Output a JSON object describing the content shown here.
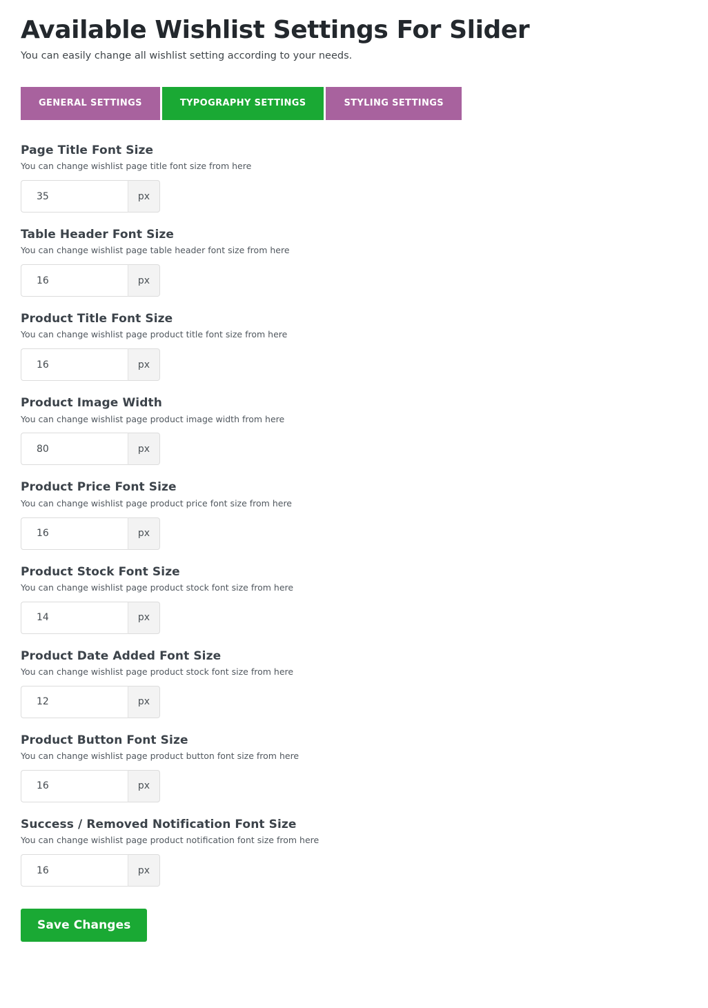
{
  "header": {
    "title": "Available Wishlist Settings For Slider",
    "subtitle": "You can easily change all wishlist setting according to your needs."
  },
  "colors": {
    "tab_inactive": "#a8629e",
    "tab_active": "#1aa934",
    "save_button": "#1aa934",
    "title_text": "#23282d",
    "addon_background": "#f3f3f3"
  },
  "tabs": [
    {
      "label": "GENERAL SETTINGS",
      "active": false
    },
    {
      "label": "TYPOGRAPHY SETTINGS",
      "active": true
    },
    {
      "label": "STYLING SETTINGS",
      "active": false
    }
  ],
  "settings": [
    {
      "title": "Page Title Font Size",
      "description": "You can change wishlist page title font size from here",
      "value": "35",
      "unit": "px"
    },
    {
      "title": "Table Header Font Size",
      "description": "You can change wishlist page table header font size from here",
      "value": "16",
      "unit": "px"
    },
    {
      "title": "Product Title Font Size",
      "description": "You can change wishlist page product title font size from here",
      "value": "16",
      "unit": "px"
    },
    {
      "title": "Product Image Width",
      "description": "You can change wishlist page product image width from here",
      "value": "80",
      "unit": "px"
    },
    {
      "title": "Product Price Font Size",
      "description": "You can change wishlist page product price font size from here",
      "value": "16",
      "unit": "px"
    },
    {
      "title": "Product Stock Font Size",
      "description": "You can change wishlist page product stock font size from here",
      "value": "14",
      "unit": "px"
    },
    {
      "title": "Product Date Added Font Size",
      "description": "You can change wishlist page product stock font size from here",
      "value": "12",
      "unit": "px"
    },
    {
      "title": "Product Button Font Size",
      "description": "You can change wishlist page product button font size from here",
      "value": "16",
      "unit": "px"
    },
    {
      "title": "Success / Removed Notification Font Size",
      "description": "You can change wishlist page product notification font size from here",
      "value": "16",
      "unit": "px"
    }
  ],
  "save": {
    "label": "Save Changes"
  }
}
